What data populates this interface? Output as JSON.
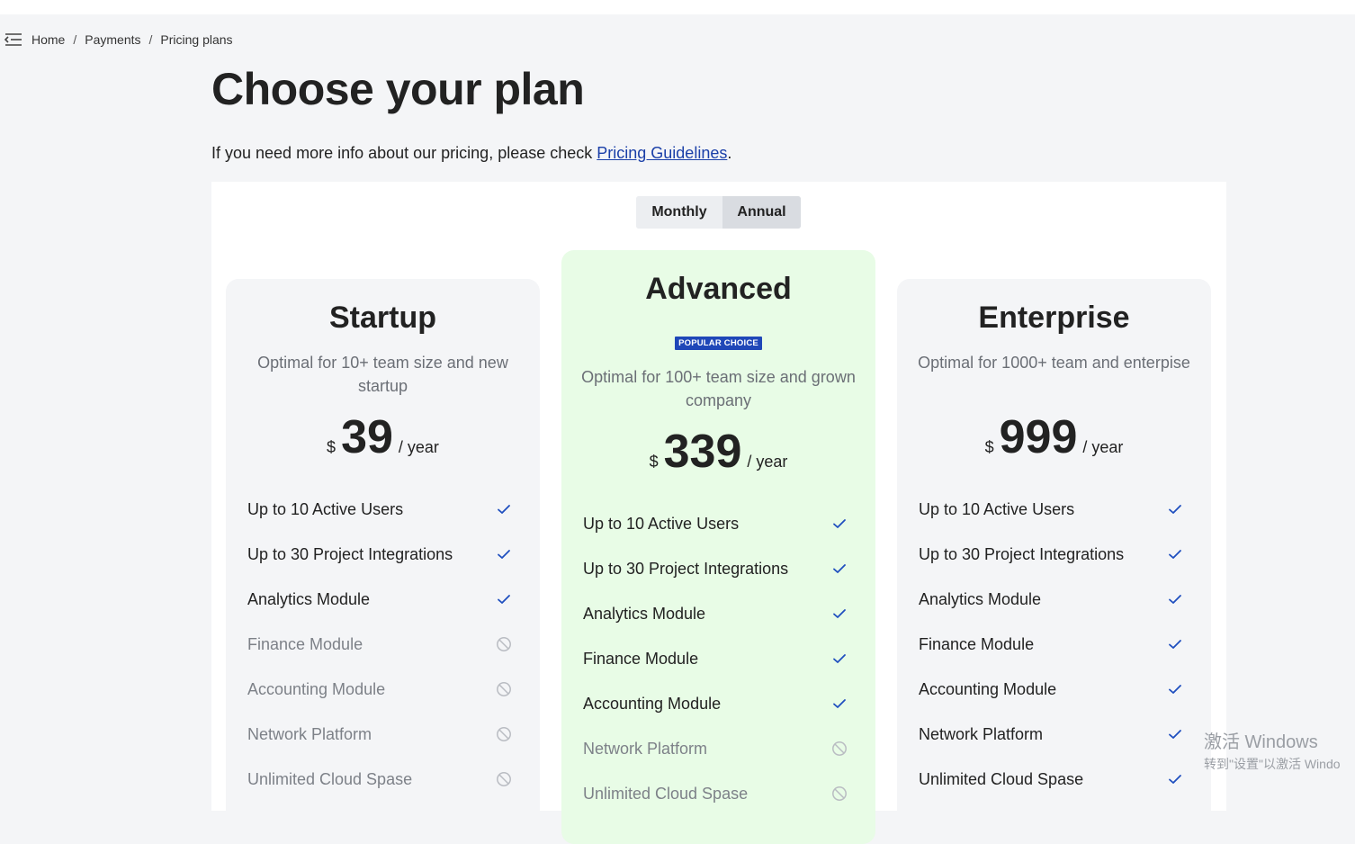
{
  "breadcrumb": {
    "items": [
      "Home",
      "Payments",
      "Pricing plans"
    ],
    "separator": "/"
  },
  "page": {
    "title": "Choose your plan",
    "intro_text": "If you need more info about our pricing, please check ",
    "intro_link": "Pricing Guidelines",
    "intro_end": "."
  },
  "billing_toggle": {
    "monthly": "Monthly",
    "annual": "Annual",
    "selected": "Annual"
  },
  "plans": [
    {
      "name": "Startup",
      "description": "Optimal for 10+ team size and new startup",
      "currency": "$",
      "price": "39",
      "period": "/ year",
      "features": [
        {
          "label": "Up to 10 Active Users",
          "included": true
        },
        {
          "label": "Up to 30 Project Integrations",
          "included": true
        },
        {
          "label": "Analytics Module",
          "included": true
        },
        {
          "label": "Finance Module",
          "included": false
        },
        {
          "label": "Accounting Module",
          "included": false
        },
        {
          "label": "Network Platform",
          "included": false
        },
        {
          "label": "Unlimited Cloud Spase",
          "included": false
        }
      ]
    },
    {
      "name": "Advanced",
      "badge": "POPULAR CHOICE",
      "description": "Optimal for 100+ team size and grown company",
      "currency": "$",
      "price": "339",
      "period": "/ year",
      "features": [
        {
          "label": "Up to 10 Active Users",
          "included": true
        },
        {
          "label": "Up to 30 Project Integrations",
          "included": true
        },
        {
          "label": "Analytics Module",
          "included": true
        },
        {
          "label": "Finance Module",
          "included": true
        },
        {
          "label": "Accounting Module",
          "included": true
        },
        {
          "label": "Network Platform",
          "included": false
        },
        {
          "label": "Unlimited Cloud Spase",
          "included": false
        }
      ]
    },
    {
      "name": "Enterprise",
      "description": "Optimal for 1000+ team and enterpise",
      "currency": "$",
      "price": "999",
      "period": "/ year",
      "features": [
        {
          "label": "Up to 10 Active Users",
          "included": true
        },
        {
          "label": "Up to 30 Project Integrations",
          "included": true
        },
        {
          "label": "Analytics Module",
          "included": true
        },
        {
          "label": "Finance Module",
          "included": true
        },
        {
          "label": "Accounting Module",
          "included": true
        },
        {
          "label": "Network Platform",
          "included": true
        },
        {
          "label": "Unlimited Cloud Spase",
          "included": true
        }
      ]
    }
  ],
  "watermark": {
    "line1": "激活 Windows",
    "line2": "转到\"设置\"以激活 Windo"
  },
  "colors": {
    "check": "#1f4fbf",
    "excluded": "#b9bcc2",
    "popular_bg": "#e8fce6",
    "badge_bg": "#1f47b8",
    "link": "#1a3fa8"
  }
}
